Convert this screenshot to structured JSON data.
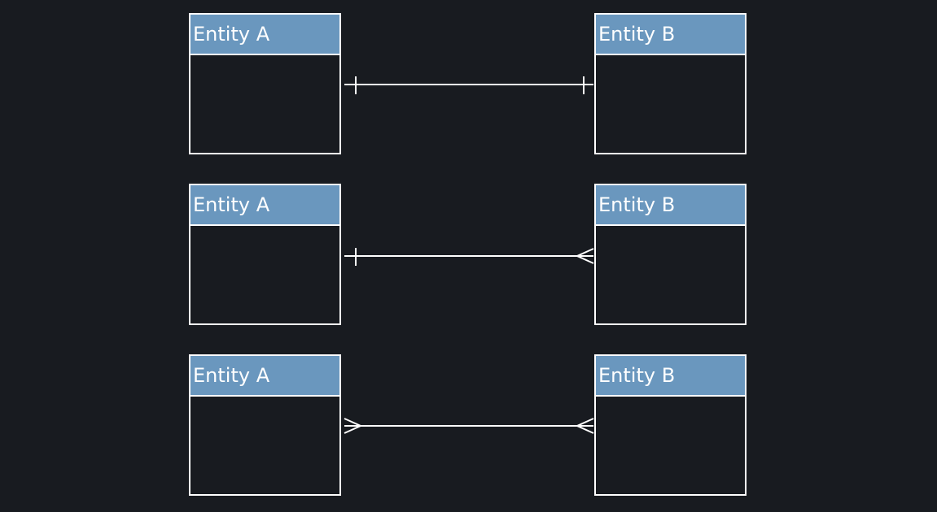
{
  "diagram": {
    "rows": [
      {
        "left": {
          "title": "Entity A"
        },
        "right": {
          "title": "Entity B"
        },
        "relationship": {
          "left_end": "one",
          "right_end": "one"
        }
      },
      {
        "left": {
          "title": "Entity A"
        },
        "right": {
          "title": "Entity B"
        },
        "relationship": {
          "left_end": "one",
          "right_end": "many"
        }
      },
      {
        "left": {
          "title": "Entity A"
        },
        "right": {
          "title": "Entity B"
        },
        "relationship": {
          "left_end": "many",
          "right_end": "many"
        }
      }
    ],
    "colors": {
      "background": "#181b20",
      "header": "#6a97be",
      "stroke": "#ffffff"
    }
  }
}
